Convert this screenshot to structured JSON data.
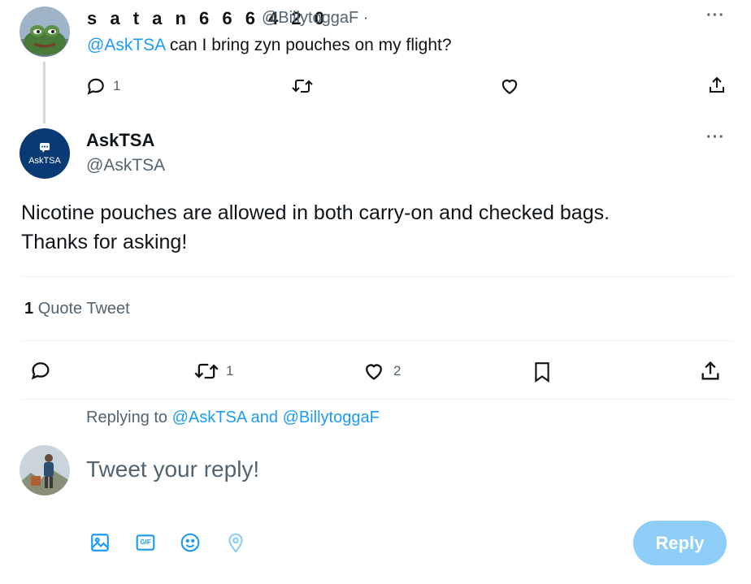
{
  "parent_tweet": {
    "display_name": "s a t a n 6 6 6 4 2 0",
    "handle": "@BillytoggaF ·",
    "mention": "@AskTSA",
    "text": " can I bring zyn pouches on my flight?",
    "reply_count": "1",
    "more_label": "···"
  },
  "main_tweet": {
    "avatar_text": "AskTSA",
    "display_name": "AskTSA",
    "handle": "@AskTSA",
    "text_line1": "Nicotine pouches are allowed in both carry-on and checked bags.",
    "text_line2": "Thanks for asking!",
    "more_label": "···",
    "quote_count": "1",
    "quote_label": "Quote Tweet",
    "retweet_count": "1",
    "like_count": "2"
  },
  "reply_composer": {
    "replying_prefix": "Replying to",
    "mention1": "@AskTSA",
    "and_label": "and",
    "mention2": "@BillytoggaF",
    "placeholder": "Tweet your reply!",
    "reply_button": "Reply",
    "gif_label": "GIF"
  },
  "colors": {
    "accent": "#1d9bf0",
    "muted_text": "#536471",
    "reply_button_disabled": "#8ecdf7",
    "asktsa_avatar_bg": "#0a3a73"
  },
  "icons": {
    "reply": "reply-icon",
    "retweet": "retweet-icon",
    "like": "heart-icon",
    "bookmark": "bookmark-icon",
    "share": "share-icon",
    "image": "image-icon",
    "gif": "gif-icon",
    "emoji": "emoji-icon",
    "location": "location-icon"
  }
}
